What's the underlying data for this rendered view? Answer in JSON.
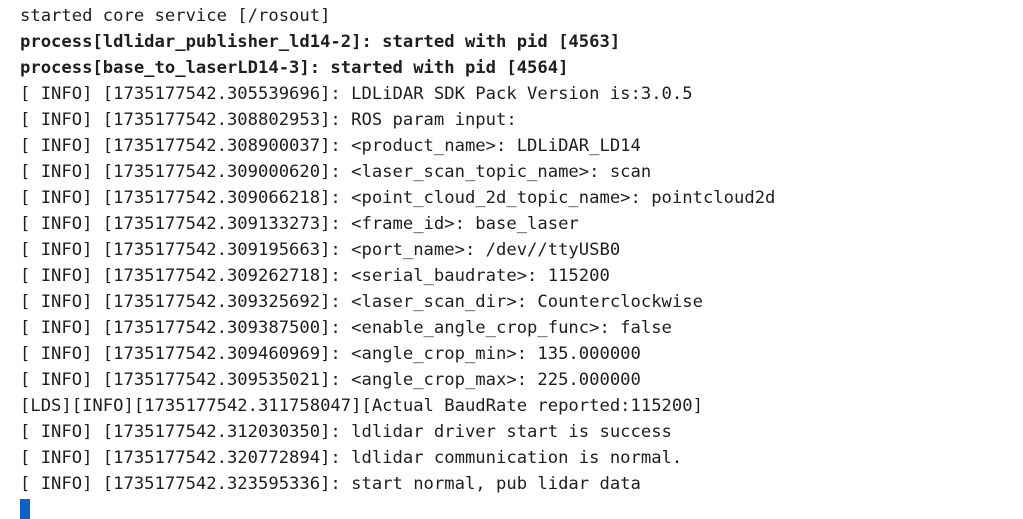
{
  "terminal": {
    "lines": [
      {
        "text": "started core service [/rosout]",
        "bold": false
      },
      {
        "text": "process[ldlidar_publisher_ld14-2]: started with pid [4563]",
        "bold": true
      },
      {
        "text": "process[base_to_laserLD14-3]: started with pid [4564]",
        "bold": true
      },
      {
        "text": "[ INFO] [1735177542.305539696]: LDLiDAR SDK Pack Version is:3.0.5",
        "bold": false
      },
      {
        "text": "[ INFO] [1735177542.308802953]: ROS param input:",
        "bold": false
      },
      {
        "text": "[ INFO] [1735177542.308900037]: <product_name>: LDLiDAR_LD14",
        "bold": false
      },
      {
        "text": "[ INFO] [1735177542.309000620]: <laser_scan_topic_name>: scan",
        "bold": false
      },
      {
        "text": "[ INFO] [1735177542.309066218]: <point_cloud_2d_topic_name>: pointcloud2d",
        "bold": false
      },
      {
        "text": "[ INFO] [1735177542.309133273]: <frame_id>: base_laser",
        "bold": false
      },
      {
        "text": "[ INFO] [1735177542.309195663]: <port_name>: /dev//ttyUSB0",
        "bold": false
      },
      {
        "text": "[ INFO] [1735177542.309262718]: <serial_baudrate>: 115200",
        "bold": false
      },
      {
        "text": "[ INFO] [1735177542.309325692]: <laser_scan_dir>: Counterclockwise",
        "bold": false
      },
      {
        "text": "[ INFO] [1735177542.309387500]: <enable_angle_crop_func>: false",
        "bold": false
      },
      {
        "text": "[ INFO] [1735177542.309460969]: <angle_crop_min>: 135.000000",
        "bold": false
      },
      {
        "text": "[ INFO] [1735177542.309535021]: <angle_crop_max>: 225.000000",
        "bold": false
      },
      {
        "text": "[LDS][INFO][1735177542.311758047][Actual BaudRate reported:115200]",
        "bold": false
      },
      {
        "text": "[ INFO] [1735177542.312030350]: ldlidar driver start is success",
        "bold": false
      },
      {
        "text": "[ INFO] [1735177542.320772894]: ldlidar communication is normal.",
        "bold": false
      },
      {
        "text": "[ INFO] [1735177542.323595336]: start normal, pub lidar data",
        "bold": false
      }
    ],
    "cursor_color": "#0a64c8",
    "text_color": "#1e1e1e",
    "background_color": "#ffffff"
  }
}
